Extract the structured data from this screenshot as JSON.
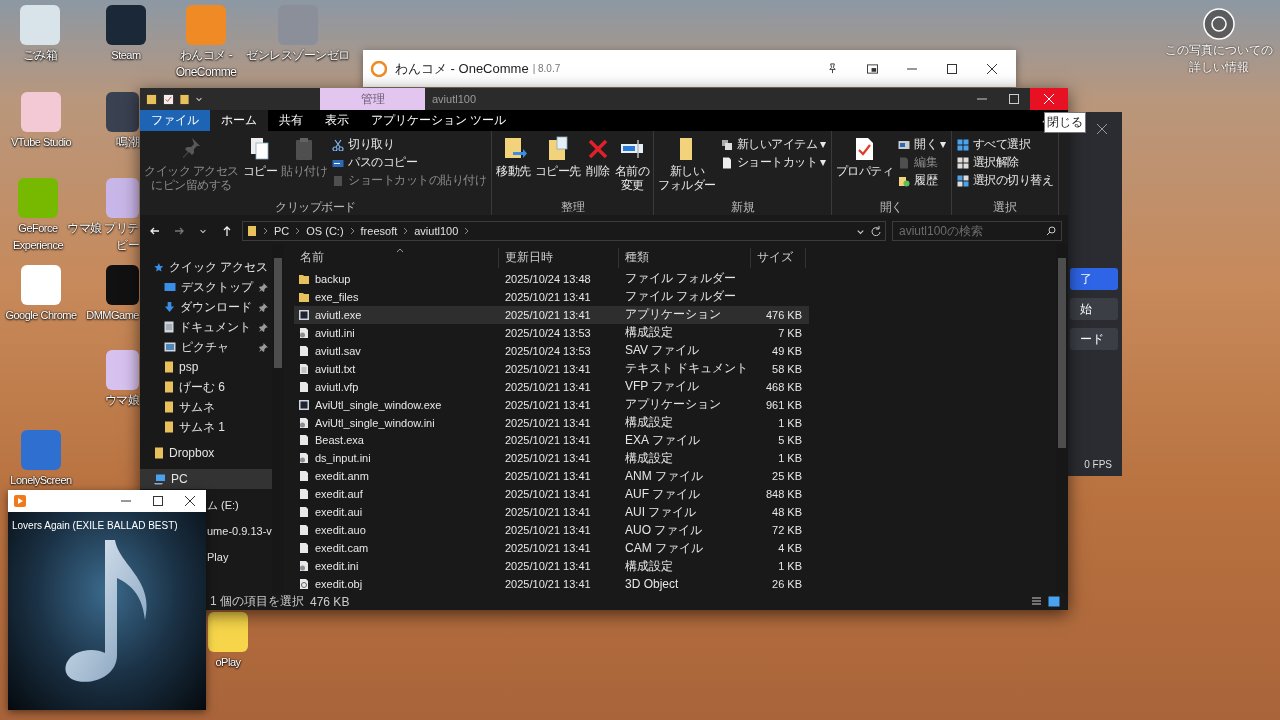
{
  "desktop": {
    "icons": [
      {
        "label": [
          "ごみ箱"
        ]
      },
      {
        "label": [
          "Steam"
        ]
      },
      {
        "label": [
          "わんコメ -",
          "OneComme"
        ]
      },
      {
        "label": [
          "ゼンレスゾーンゼロ"
        ]
      },
      {
        "label": [
          "VTube Studio"
        ]
      },
      {
        "label": [
          "鳴潮"
        ]
      },
      {
        "label": [
          "GeForce",
          "Experience"
        ]
      },
      {
        "label": [
          "ウマ娘 プリテ",
          "ビー"
        ]
      },
      {
        "label": [
          "Google Chrome"
        ]
      },
      {
        "label": [
          "DMMGame"
        ]
      },
      {
        "label": [
          "ウマ娘"
        ]
      },
      {
        "label": [
          "LonelyScreen"
        ]
      },
      {
        "label": [
          "oPlay"
        ]
      }
    ],
    "photo_info": [
      "この写真についての",
      "詳しい情報"
    ]
  },
  "onecomme_window": {
    "title": "わんコメ - OneComme",
    "version": "| 8.0.7"
  },
  "side_panel": {
    "buttons": [
      {
        "label": "了",
        "kind": "primary"
      },
      {
        "label": "始",
        "kind": "plain"
      },
      {
        "label": "ード",
        "kind": "plain"
      }
    ],
    "status": "0 FPS"
  },
  "explorer": {
    "context_tab": "管理",
    "title": "aviutl100",
    "tabs": [
      {
        "label": "ファイル",
        "kind": "menu",
        "selected": false
      },
      {
        "label": "ホーム",
        "kind": "tab",
        "selected": true
      },
      {
        "label": "共有",
        "kind": "tab",
        "selected": false
      },
      {
        "label": "表示",
        "kind": "tab",
        "selected": false
      },
      {
        "label": "アプリケーション ツール",
        "kind": "tab",
        "selected": false
      }
    ],
    "close_tooltip": "閉じる",
    "ribbon": [
      {
        "label": "クリップボード",
        "large": [
          {
            "lines": [
              "クイック アクセス",
              "にピン留めする"
            ],
            "disabled": true
          },
          {
            "lines": [
              "コピー"
            ],
            "disabled": false
          },
          {
            "lines": [
              "貼り付け"
            ],
            "disabled": true
          }
        ],
        "small": [
          {
            "label": "切り取り",
            "disabled": false
          },
          {
            "label": "パスのコピー",
            "disabled": false
          },
          {
            "label": "ショートカットの貼り付け",
            "disabled": true
          }
        ]
      },
      {
        "label": "整理",
        "large": [
          {
            "lines": [
              "移動先"
            ],
            "disabled": false
          },
          {
            "lines": [
              "コピー先"
            ],
            "disabled": false
          },
          {
            "lines": [
              "削除"
            ],
            "disabled": false
          },
          {
            "lines": [
              "名前の",
              "変更"
            ],
            "disabled": false
          }
        ]
      },
      {
        "label": "新規",
        "large": [
          {
            "lines": [
              "新しい",
              "フォルダー"
            ],
            "disabled": false
          }
        ],
        "small": [
          {
            "label": "新しいアイテム ▾",
            "disabled": false
          },
          {
            "label": "ショートカット ▾",
            "disabled": false
          }
        ]
      },
      {
        "label": "開く",
        "large": [
          {
            "lines": [
              "プロパティ"
            ],
            "disabled": false
          }
        ],
        "small": [
          {
            "label": "開く ▾",
            "disabled": false
          },
          {
            "label": "編集",
            "disabled": true
          },
          {
            "label": "履歴",
            "disabled": false
          }
        ]
      },
      {
        "label": "選択",
        "small": [
          {
            "label": "すべて選択",
            "disabled": false
          },
          {
            "label": "選択解除",
            "disabled": false
          },
          {
            "label": "選択の切り替え",
            "disabled": false
          }
        ]
      }
    ],
    "breadcrumb": [
      "PC",
      "OS (C:)",
      "freesoft",
      "aviutl100"
    ],
    "search": {
      "placeholder": "aviutl100の検索"
    },
    "nav": [
      {
        "label": "クイック アクセス",
        "kind": "star",
        "selected": false,
        "pinned": false,
        "children": [
          {
            "label": "デスクトップ",
            "kind": "desktop",
            "selected": false,
            "pinned": true
          },
          {
            "label": "ダウンロード",
            "kind": "download",
            "selected": false,
            "pinned": true
          },
          {
            "label": "ドキュメント",
            "kind": "document",
            "selected": false,
            "pinned": true
          },
          {
            "label": "ピクチャ",
            "kind": "picture",
            "selected": false,
            "pinned": true
          },
          {
            "label": "psp",
            "kind": "folder",
            "selected": false,
            "pinned": false
          },
          {
            "label": "げーむ 6",
            "kind": "folder",
            "selected": false,
            "pinned": false
          },
          {
            "label": "サムネ",
            "kind": "folder",
            "selected": false,
            "pinned": false
          },
          {
            "label": "サムネ 1",
            "kind": "folder",
            "selected": false,
            "pinned": false
          }
        ]
      },
      {
        "label": "Dropbox",
        "kind": "folder",
        "selected": false,
        "pinned": false
      },
      {
        "label": "PC",
        "kind": "pc",
        "selected": true,
        "pinned": false
      },
      {
        "label": "ム (E:)",
        "kind": "none",
        "selected": false,
        "pinned": false
      },
      {
        "label": "ume-0.9.13-v",
        "kind": "none",
        "selected": false,
        "pinned": false
      },
      {
        "label": "Play",
        "kind": "none",
        "selected": false,
        "pinned": false
      }
    ],
    "columns": [
      {
        "label": "名前",
        "sorted": true
      },
      {
        "label": "更新日時",
        "sorted": false
      },
      {
        "label": "種類",
        "sorted": false
      },
      {
        "label": "サイズ",
        "sorted": false
      }
    ],
    "rows": [
      {
        "name": "backup",
        "date": "2025/10/24 13:48",
        "type": "ファイル フォルダー",
        "kind": "folder",
        "selected": false
      },
      {
        "name": "exe_files",
        "date": "2025/10/21 13:41",
        "type": "ファイル フォルダー",
        "kind": "folder",
        "selected": false
      },
      {
        "name": "aviutl.exe",
        "date": "2025/10/21 13:41",
        "type": "アプリケーション",
        "size": "476 KB",
        "kind": "exe",
        "selected": true
      },
      {
        "name": "aviutl.ini",
        "date": "2025/10/24 13:53",
        "type": "構成設定",
        "size": "7 KB",
        "kind": "ini",
        "selected": false
      },
      {
        "name": "aviutl.sav",
        "date": "2025/10/24 13:53",
        "type": "SAV ファイル",
        "size": "49 KB",
        "kind": "file",
        "selected": false
      },
      {
        "name": "aviutl.txt",
        "date": "2025/10/21 13:41",
        "type": "テキスト ドキュメント",
        "size": "58 KB",
        "kind": "txt",
        "selected": false
      },
      {
        "name": "aviutl.vfp",
        "date": "2025/10/21 13:41",
        "type": "VFP ファイル",
        "size": "468 KB",
        "kind": "file",
        "selected": false
      },
      {
        "name": "AviUtl_single_window.exe",
        "date": "2025/10/21 13:41",
        "type": "アプリケーション",
        "size": "961 KB",
        "kind": "exe",
        "selected": false
      },
      {
        "name": "AviUtl_single_window.ini",
        "date": "2025/10/21 13:41",
        "type": "構成設定",
        "size": "1 KB",
        "kind": "ini",
        "selected": false
      },
      {
        "name": "Beast.exa",
        "date": "2025/10/21 13:41",
        "type": "EXA ファイル",
        "size": "5 KB",
        "kind": "file",
        "selected": false
      },
      {
        "name": "ds_input.ini",
        "date": "2025/10/21 13:41",
        "type": "構成設定",
        "size": "1 KB",
        "kind": "ini",
        "selected": false
      },
      {
        "name": "exedit.anm",
        "date": "2025/10/21 13:41",
        "type": "ANM ファイル",
        "size": "25 KB",
        "kind": "file",
        "selected": false
      },
      {
        "name": "exedit.auf",
        "date": "2025/10/21 13:41",
        "type": "AUF ファイル",
        "size": "848 KB",
        "kind": "file",
        "selected": false
      },
      {
        "name": "exedit.aui",
        "date": "2025/10/21 13:41",
        "type": "AUI ファイル",
        "size": "48 KB",
        "kind": "file",
        "selected": false
      },
      {
        "name": "exedit.auo",
        "date": "2025/10/21 13:41",
        "type": "AUO ファイル",
        "size": "72 KB",
        "kind": "file",
        "selected": false
      },
      {
        "name": "exedit.cam",
        "date": "2025/10/21 13:41",
        "type": "CAM ファイル",
        "size": "4 KB",
        "kind": "file",
        "selected": false
      },
      {
        "name": "exedit.ini",
        "date": "2025/10/21 13:41",
        "type": "構成設定",
        "size": "1 KB",
        "kind": "ini",
        "selected": false
      },
      {
        "name": "exedit.obj",
        "date": "2025/10/21 13:41",
        "type": "3D Object",
        "size": "26 KB",
        "kind": "obj",
        "selected": false
      }
    ],
    "status": {
      "selection": "1 個の項目を選択",
      "size": "476 KB"
    }
  },
  "media_player": {
    "track": "Lovers Again (EXILE BALLAD BEST)"
  }
}
